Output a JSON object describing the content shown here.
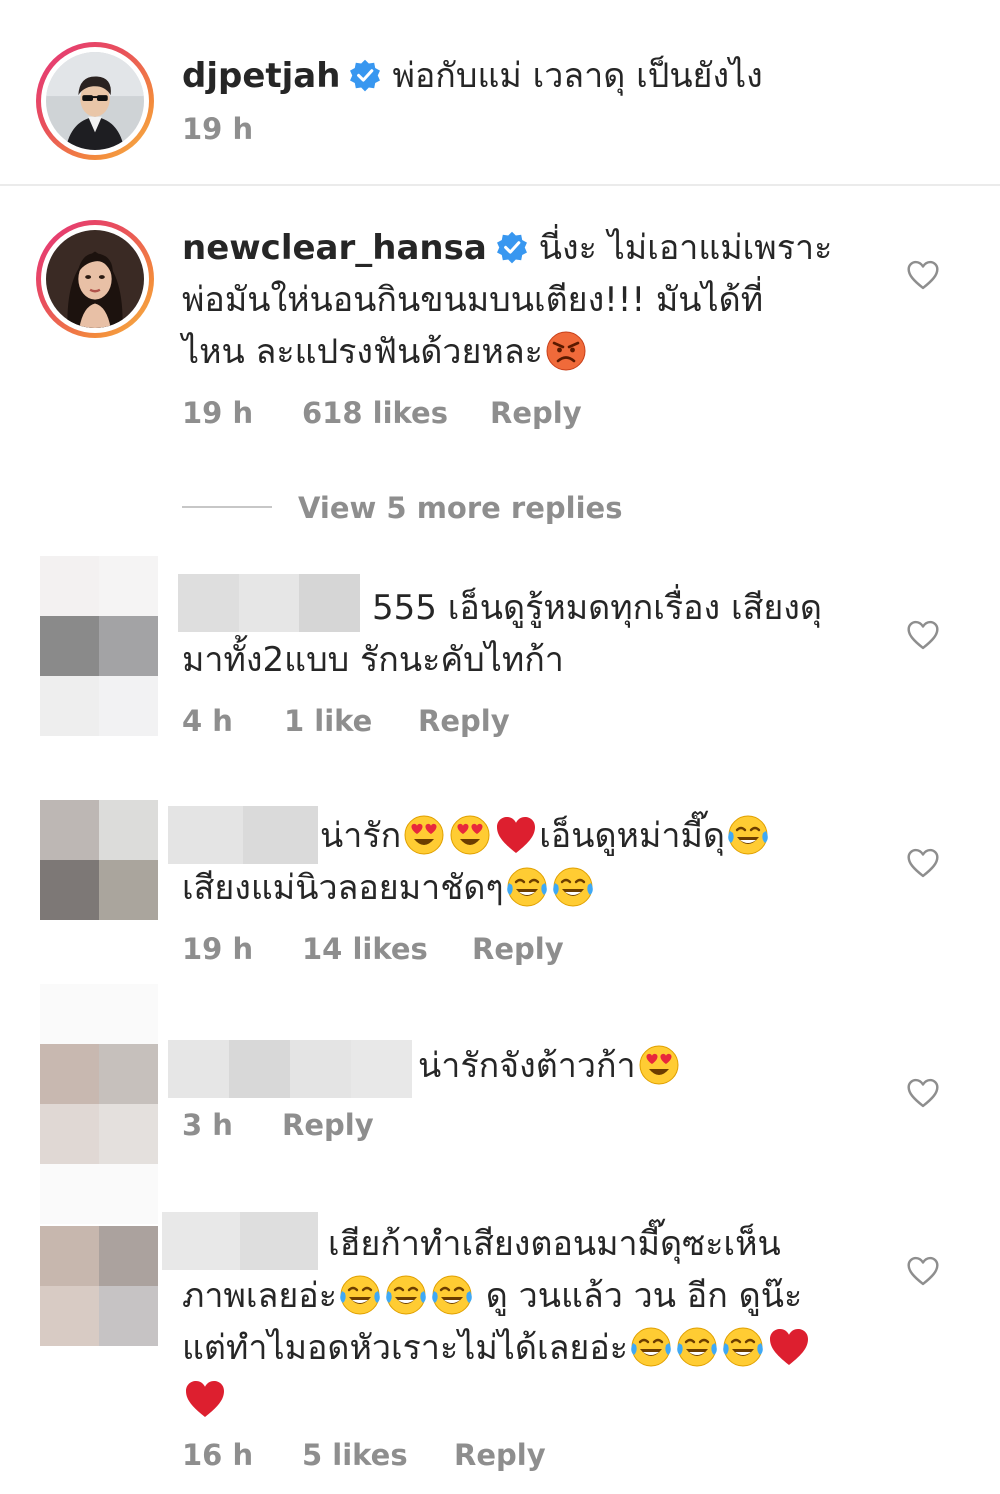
{
  "post": {
    "username": "djpetjah",
    "caption": "พ่อกับแม่ เวลาดุ  เป็นยังไง",
    "time": "19 h"
  },
  "comments": [
    {
      "username": "newclear_hansa",
      "lines": [
        "นี่งะ ไม่เอาแม่เพราะ",
        "พ่อมันให่นอนกินขนมบนเตียง!!! มันได้ที่",
        "ไหน ละแปรงฟันด้วยหละ"
      ],
      "time": "19 h",
      "likes": "618 likes",
      "reply": "Reply",
      "view_replies": "View 5 more replies"
    },
    {
      "lines": [
        "555 เอ็นดูรู้หมดทุกเรื่อง เสียงดุ",
        "มาทั้ง2แบบ รักนะคับไทก้า"
      ],
      "time": "4 h",
      "likes": "1 like",
      "reply": "Reply"
    },
    {
      "lines": [
        "น่ารัก",
        "เอ็นดูหม่ามี๊ดุ",
        "เสียงแม่นิวลอยมาชัดๆ"
      ],
      "time": "19 h",
      "likes": "14 likes",
      "reply": "Reply"
    },
    {
      "lines": [
        "น่ารักจังต้าวก้า"
      ],
      "time": "3 h",
      "reply": "Reply"
    },
    {
      "lines": [
        "เฮียก้าทำเสียงตอนมามี๊ดุซะเห็น",
        "ภาพเลยอ่ะ",
        " ดู วนแล้ว วน อีก ดูน๊ะ",
        "แต่ทำไมอดหัวเราะไม่ได้เลยอ่ะ"
      ],
      "time": "16 h",
      "likes": "5 likes",
      "reply": "Reply"
    }
  ],
  "icons": {
    "verified": "verified-badge-icon",
    "heart": "heart-outline-icon",
    "emoji": [
      "angry-face-emoji",
      "heart-eyes-emoji",
      "red-heart-emoji",
      "tears-of-joy-emoji"
    ]
  },
  "colors": {
    "verified": "#3897f0",
    "meta": "#8e8e8e",
    "text": "#262626"
  }
}
